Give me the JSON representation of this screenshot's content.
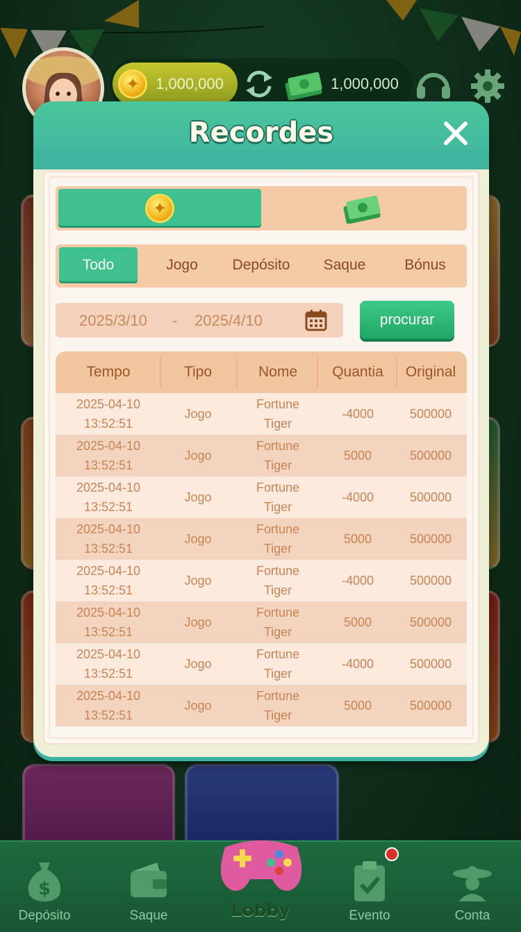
{
  "top_bar": {
    "coin_balance": "1,000,000",
    "cash_balance": "1,000,000"
  },
  "modal": {
    "title": "Recordes",
    "currency_options": [
      "coin",
      "cash"
    ],
    "selected_currency": "coin",
    "tabs": [
      {
        "label": "Todo",
        "active": true
      },
      {
        "label": "Jogo",
        "active": false
      },
      {
        "label": "Depósito",
        "active": false
      },
      {
        "label": "Saque",
        "active": false
      },
      {
        "label": "Bónus",
        "active": false
      }
    ],
    "date_from": "2025/3/10",
    "date_separator": "-",
    "date_to": "2025/4/10",
    "search_label": "procurar",
    "table": {
      "headers": [
        "Tempo",
        "Tipo",
        "Nome",
        "Quantia",
        "Original"
      ],
      "rows": [
        {
          "date": "2025-04-10",
          "time": "13:52:51",
          "type": "Jogo",
          "name1": "Fortune",
          "name2": "Tiger",
          "amount": "-4000",
          "original": "500000"
        },
        {
          "date": "2025-04-10",
          "time": "13:52:51",
          "type": "Jogo",
          "name1": "Fortune",
          "name2": "Tiger",
          "amount": "5000",
          "original": "500000"
        },
        {
          "date": "2025-04-10",
          "time": "13:52:51",
          "type": "Jogo",
          "name1": "Fortune",
          "name2": "Tiger",
          "amount": "-4000",
          "original": "500000"
        },
        {
          "date": "2025-04-10",
          "time": "13:52:51",
          "type": "Jogo",
          "name1": "Fortune",
          "name2": "Tiger",
          "amount": "5000",
          "original": "500000"
        },
        {
          "date": "2025-04-10",
          "time": "13:52:51",
          "type": "Jogo",
          "name1": "Fortune",
          "name2": "Tiger",
          "amount": "-4000",
          "original": "500000"
        },
        {
          "date": "2025-04-10",
          "time": "13:52:51",
          "type": "Jogo",
          "name1": "Fortune",
          "name2": "Tiger",
          "amount": "5000",
          "original": "500000"
        },
        {
          "date": "2025-04-10",
          "time": "13:52:51",
          "type": "Jogo",
          "name1": "Fortune",
          "name2": "Tiger",
          "amount": "-4000",
          "original": "500000"
        },
        {
          "date": "2025-04-10",
          "time": "13:52:51",
          "type": "Jogo",
          "name1": "Fortune",
          "name2": "Tiger",
          "amount": "5000",
          "original": "500000"
        }
      ]
    }
  },
  "bottom_nav": {
    "items": [
      {
        "label": "Depósito",
        "icon": "money-bag-icon"
      },
      {
        "label": "Saque",
        "icon": "wallet-icon"
      },
      {
        "label": "Lobby",
        "icon": "gamepad-icon"
      },
      {
        "label": "Evento",
        "icon": "clipboard-check-icon"
      },
      {
        "label": "Conta",
        "icon": "sombrero-user-icon"
      }
    ],
    "active": "Lobby"
  },
  "colors": {
    "accent_green": "#3ec18e",
    "header_teal": "#4bc59c",
    "table_header": "#f2c7a0",
    "text_brown": "#9b5426"
  }
}
